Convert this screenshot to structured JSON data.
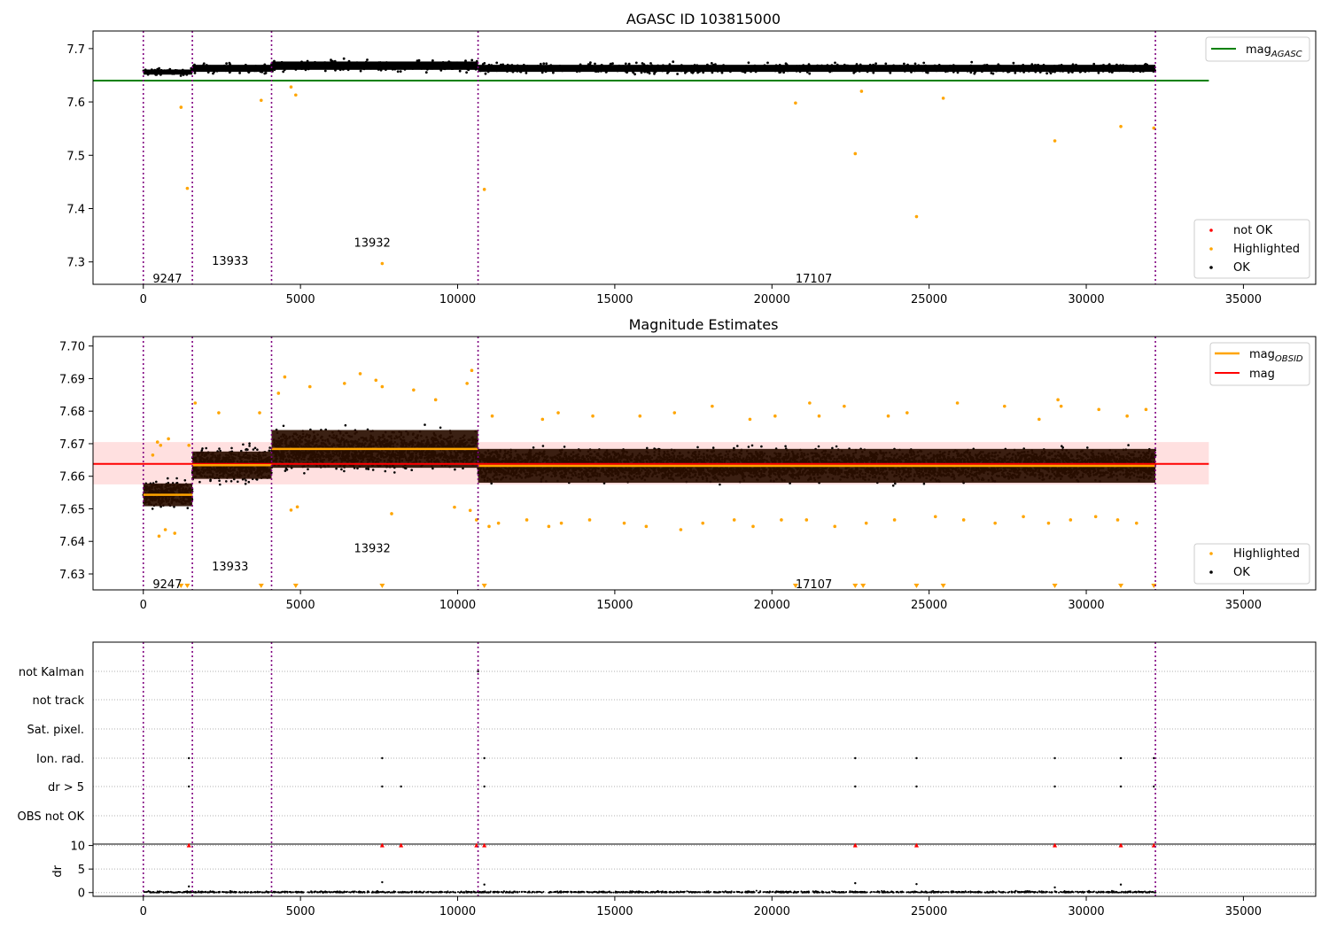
{
  "chart_data": [
    {
      "type": "scatter",
      "title": "AGASC ID 103815000",
      "xlabel": "",
      "ylabel": "",
      "xlim": [
        -1600,
        37300
      ],
      "ylim": [
        7.258,
        7.733
      ],
      "xticks": [
        0,
        5000,
        10000,
        15000,
        20000,
        25000,
        30000,
        35000
      ],
      "yticks": [
        7.3,
        7.4,
        7.5,
        7.6,
        7.7
      ],
      "ytick_labels": [
        "7.3",
        "7.4",
        "7.5",
        "7.6",
        "7.7"
      ],
      "grid": false,
      "obs_boundaries": [
        0,
        1560,
        4080,
        10650,
        32200
      ],
      "obsid_labels": [
        {
          "text": "9247",
          "x": 300,
          "y": 7.27
        },
        {
          "text": "13933",
          "x": 2180,
          "y": 7.303
        },
        {
          "text": "13932",
          "x": 6700,
          "y": 7.337
        },
        {
          "text": "17107",
          "x": 20750,
          "y": 7.27
        }
      ],
      "reference_line": {
        "name": "mag_AGASC",
        "y": 7.64,
        "x": [
          -1600,
          33900
        ],
        "color": "#008000"
      },
      "ok_bands": [
        {
          "x0": 0,
          "x1": 1560,
          "center": 7.656,
          "spread": 0.008
        },
        {
          "x0": 1560,
          "x1": 4080,
          "center": 7.663,
          "spread": 0.011
        },
        {
          "x0": 4080,
          "x1": 10650,
          "center": 7.668,
          "spread": 0.013
        },
        {
          "x0": 10650,
          "x1": 32200,
          "center": 7.663,
          "spread": 0.011
        }
      ],
      "series": [
        {
          "name": "not OK",
          "color": "#ff0000",
          "x": [],
          "values": []
        },
        {
          "name": "Highlighted",
          "color": "#ffa500",
          "x": [
            1200,
            1400,
            3750,
            4700,
            4850,
            7600,
            10850,
            20750,
            22650,
            22850,
            24600,
            25450,
            29000,
            31100,
            32150
          ],
          "values": [
            7.59,
            7.438,
            7.603,
            7.628,
            7.613,
            7.297,
            7.436,
            7.598,
            7.503,
            7.62,
            7.385,
            7.607,
            7.527,
            7.554,
            7.551
          ]
        },
        {
          "name": "OK",
          "color": "#000000",
          "x": [],
          "values": []
        }
      ],
      "legends": [
        {
          "position": "upper-right",
          "entries": [
            "mag_AGASC"
          ]
        },
        {
          "position": "lower-right",
          "entries": [
            "not OK",
            "Highlighted",
            "OK"
          ]
        }
      ]
    },
    {
      "type": "scatter",
      "title": "Magnitude Estimates",
      "xlabel": "",
      "ylabel": "",
      "xlim": [
        -1600,
        37300
      ],
      "ylim": [
        7.6251,
        7.7029
      ],
      "xticks": [
        0,
        5000,
        10000,
        15000,
        20000,
        25000,
        30000,
        35000
      ],
      "yticks": [
        7.63,
        7.64,
        7.65,
        7.66,
        7.67,
        7.68,
        7.69,
        7.7
      ],
      "ytick_labels": [
        "7.63",
        "7.64",
        "7.65",
        "7.66",
        "7.67",
        "7.68",
        "7.69",
        "7.70"
      ],
      "grid": false,
      "obs_boundaries": [
        0,
        1560,
        4080,
        10650,
        32200
      ],
      "obsid_labels": [
        {
          "text": "9247",
          "x": 300,
          "y": 7.627
        },
        {
          "text": "13933",
          "x": 2180,
          "y": 7.6325
        },
        {
          "text": "13932",
          "x": 6700,
          "y": 7.638
        },
        {
          "text": "17107",
          "x": 20750,
          "y": 7.627
        }
      ],
      "mag": {
        "name": "mag",
        "value": 7.6638,
        "band": [
          7.6575,
          7.6705
        ],
        "x": [
          -1600,
          33900
        ],
        "color": "#ff0000"
      },
      "obsid_means": [
        {
          "name": "mag_OBSID",
          "x0": 0,
          "x1": 1560,
          "value": 7.6543,
          "err": 0.0035
        },
        {
          "name": "mag_OBSID",
          "x0": 1560,
          "x1": 4080,
          "value": 7.6634,
          "err": 0.0042
        },
        {
          "name": "mag_OBSID",
          "x0": 4080,
          "x1": 10650,
          "value": 7.6684,
          "err": 0.0058
        },
        {
          "name": "mag_OBSID",
          "x0": 10650,
          "x1": 32200,
          "value": 7.6632,
          "err": 0.0052
        }
      ],
      "ok_bands": [
        {
          "x0": 0,
          "x1": 1560,
          "center": 7.6545,
          "spread": 0.0045
        },
        {
          "x0": 1560,
          "x1": 4080,
          "center": 7.6635,
          "spread": 0.006
        },
        {
          "x0": 4080,
          "x1": 10650,
          "center": 7.668,
          "spread": 0.0067
        },
        {
          "x0": 10650,
          "x1": 32200,
          "center": 7.6635,
          "spread": 0.0055
        }
      ],
      "series": [
        {
          "name": "Highlighted",
          "color": "#ffa500",
          "x": [
            300,
            450,
            550,
            800,
            1450,
            1650,
            2400,
            3700,
            4300,
            4500,
            5300,
            6400,
            6900,
            7400,
            7600,
            8600,
            9300,
            10300,
            10450,
            11100,
            12700,
            13200,
            14300,
            15800,
            16900,
            18100,
            19300,
            20100,
            21200,
            21500,
            22300,
            23700,
            24300,
            25900,
            27400,
            28500,
            29100,
            29200,
            30400,
            31300,
            31900,
            500,
            700,
            1000,
            4700,
            4900,
            7900,
            9900,
            10400,
            10600,
            11000,
            11300,
            12200,
            12900,
            13300,
            14200,
            15300,
            16000,
            17100,
            17800,
            18800,
            19400,
            20300,
            21100,
            22000,
            23000,
            23900,
            25200,
            26100,
            27100,
            28000,
            28800,
            29500,
            30300,
            31000,
            31600
          ],
          "values": [
            7.6665,
            7.6705,
            7.6695,
            7.6715,
            7.6695,
            7.6825,
            7.6795,
            7.6795,
            7.6855,
            7.6905,
            7.6875,
            7.6885,
            7.6915,
            7.6895,
            7.6875,
            7.6865,
            7.6835,
            7.6885,
            7.6925,
            7.6785,
            7.6775,
            7.6795,
            7.6785,
            7.6785,
            7.6795,
            7.6815,
            7.6775,
            7.6785,
            7.6825,
            7.6785,
            7.6815,
            7.6785,
            7.6795,
            7.6825,
            7.6815,
            7.6775,
            7.6835,
            7.6815,
            7.6805,
            7.6785,
            7.6805,
            7.6416,
            7.6436,
            7.6425,
            7.6496,
            7.6506,
            7.6485,
            7.6505,
            7.6495,
            7.6466,
            7.6446,
            7.6456,
            7.6466,
            7.6446,
            7.6456,
            7.6466,
            7.6456,
            7.6446,
            7.6436,
            7.6456,
            7.6466,
            7.6446,
            7.6466,
            7.6466,
            7.6446,
            7.6456,
            7.6466,
            7.6476,
            7.6466,
            7.6456,
            7.6476,
            7.6456,
            7.6466,
            7.6476,
            7.6466,
            7.6456
          ]
        },
        {
          "name": "OK",
          "color": "#000000",
          "x": [],
          "values": []
        }
      ],
      "offscale_markers_x": [
        1200,
        1400,
        3750,
        4850,
        7600,
        10850,
        20750,
        22650,
        22900,
        24600,
        25450,
        29000,
        31100,
        32150
      ],
      "legends": [
        {
          "position": "upper-right",
          "entries": [
            "mag_OBSID",
            "mag"
          ]
        },
        {
          "position": "lower-right",
          "entries": [
            "Highlighted",
            "OK"
          ]
        }
      ]
    },
    {
      "type": "scatter",
      "title": "",
      "xlabel": "",
      "ylabel": "",
      "xlim": [
        -1600,
        37300
      ],
      "categories": [
        "not Kalman",
        "not track",
        "Sat. pixel.",
        "Ion. rad.",
        "dr > 5",
        "OBS not OK"
      ],
      "obs_boundaries": [
        0,
        1560,
        4080,
        10650,
        32200
      ],
      "flag_points": [
        {
          "flag": "not Kalman",
          "x": [
            10650
          ]
        },
        {
          "flag": "not track",
          "x": []
        },
        {
          "flag": "Sat. pixel.",
          "x": []
        },
        {
          "flag": "Ion. rad.",
          "x": [
            1450,
            7600,
            10850,
            22650,
            24600,
            29000,
            31100,
            32150
          ]
        },
        {
          "flag": "dr > 5",
          "x": [
            1450,
            7600,
            8200,
            10850,
            22650,
            24600,
            29000,
            31100,
            32150
          ]
        },
        {
          "flag": "OBS not OK",
          "x": []
        }
      ],
      "grid": true
    },
    {
      "type": "scatter",
      "title": "",
      "xlabel": "",
      "ylabel": "dr",
      "xlim": [
        -1600,
        37300
      ],
      "ylim": [
        -0.8,
        10.3
      ],
      "xticks": [
        0,
        5000,
        10000,
        15000,
        20000,
        25000,
        30000,
        35000
      ],
      "yticks": [
        0,
        5,
        10
      ],
      "ytick_labels": [
        "0",
        "5",
        "10"
      ],
      "grid": true,
      "obs_boundaries": [
        0,
        1560,
        4080,
        10650,
        32200
      ],
      "clipped_dr_x": [
        1450,
        7600,
        8200,
        10600,
        10850,
        22650,
        24600,
        29000,
        31100,
        32150
      ],
      "series": [
        {
          "name": "dr",
          "color": "#000000",
          "x": [
            7600,
            10850,
            22650,
            24600,
            29000,
            31100,
            1450
          ],
          "values": [
            2.2,
            1.7,
            2.0,
            1.8,
            1.1,
            1.7,
            1.3
          ]
        }
      ]
    }
  ]
}
